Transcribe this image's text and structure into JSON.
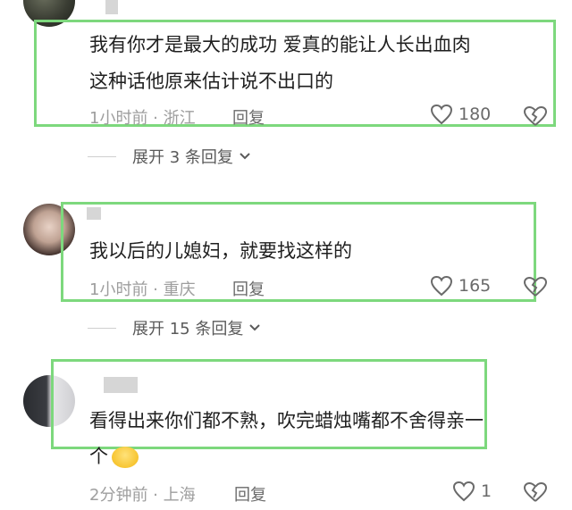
{
  "comments": [
    {
      "text_lines": [
        "我有你才是最大的成功  爱真的能让人长出血肉",
        "这种话他原来估计说不出口的"
      ],
      "time": "1小时前",
      "location": "浙江",
      "reply_label": "回复",
      "likes": "180",
      "expand_label": "展开 3 条回复"
    },
    {
      "text_lines": [
        "我以后的儿媳妇，就要找这样的"
      ],
      "time": "1小时前",
      "location": "重庆",
      "reply_label": "回复",
      "likes": "165",
      "expand_label": "展开 15 条回复"
    },
    {
      "text_lines": [
        "看得出来你们都不熟，吹完蜡烛嘴都不舍得亲一",
        "个"
      ],
      "time": "2分钟前",
      "location": "上海",
      "reply_label": "回复",
      "likes": "1"
    }
  ],
  "colors": {
    "highlight_box": "#7dd87d",
    "meta_text": "#9e9e9e"
  },
  "icons": {
    "like": "heart-outline-icon",
    "dislike": "broken-heart-icon",
    "expand": "chevron-down-icon",
    "emoji": "grinning-face-emoji"
  }
}
